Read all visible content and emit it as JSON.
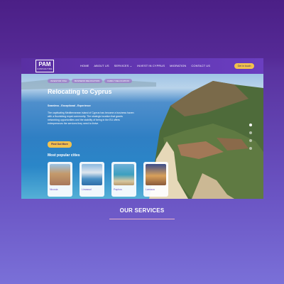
{
  "nav": {
    "logo": "PAM",
    "logo_sub": "CONSULTING",
    "items": [
      "HOME",
      "ABOUT US",
      "SERVICES ⌄",
      "INVEST IN CYPRUS",
      "MIGRATION",
      "CONTACT US"
    ],
    "cta": "Get in touch"
  },
  "hero": {
    "tags": [
      "INVESTOR VISA",
      "BUSINESS RELOCATION",
      "FAMILY RELOCATION"
    ],
    "title": "Relocating to Cyprus",
    "subtitle": "Seamless - Exceptional - Experience",
    "body": "The captivating Mediterranean island of Cyprus has become a business haven with a flourishing expat community. The strategic location that grants networking opportunities and the stability of being in the EU offers entrepreneurs the services they need to thrive.",
    "button": "Find Out More",
    "popular_title": "Most popular cities",
    "cities": [
      {
        "name": "Nicosia",
        "color": "#c49a6c"
      },
      {
        "name": "Limassol",
        "color": "#4a8fc4"
      },
      {
        "name": "Paphos",
        "color": "#3c9fbf"
      },
      {
        "name": "Larnaca",
        "color": "#d8a05a"
      }
    ],
    "slider_dots": 4,
    "active_dot": 0
  },
  "services": {
    "heading": "OUR SERVICES"
  }
}
